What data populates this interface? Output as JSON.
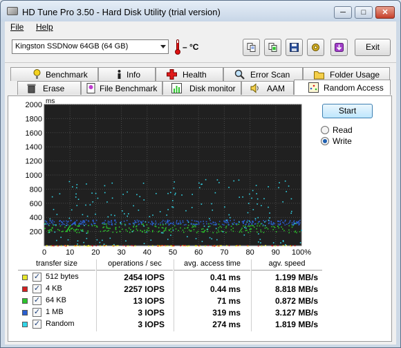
{
  "window": {
    "title": "HD Tune Pro 3.50 - Hard Disk Utility (trial version)",
    "min_label": "─",
    "max_label": "□",
    "close_label": "✕"
  },
  "menu": {
    "file": "File",
    "help": "Help"
  },
  "toolbar": {
    "drive": "Kingston SSDNow 64GB (64 GB)",
    "temperature": "– °C",
    "exit_label": "Exit",
    "icons": [
      "copy-icon",
      "copy-info-icon",
      "save-icon",
      "options-icon",
      "download-icon"
    ]
  },
  "tabs_row1": [
    "Benchmark",
    "Info",
    "Health",
    "Error Scan",
    "Folder Usage"
  ],
  "tabs_row2": [
    "Erase",
    "File Benchmark",
    "Disk monitor",
    "AAM",
    "Random Access"
  ],
  "active_tab": "Random Access",
  "controls": {
    "start_label": "Start",
    "read_label": "Read",
    "write_label": "Write",
    "mode": "Write"
  },
  "table": {
    "headers": [
      "transfer size",
      "operations / sec",
      "avg. access time",
      "agv. speed"
    ],
    "rows": [
      {
        "size": "512 bytes",
        "ops": "2454 IOPS",
        "time": "0.41 ms",
        "speed": "1.199 MB/s",
        "color": "#e8e82a",
        "checked": true
      },
      {
        "size": "4 KB",
        "ops": "2257 IOPS",
        "time": "0.44 ms",
        "speed": "8.818 MB/s",
        "color": "#d42020",
        "checked": true
      },
      {
        "size": "64 KB",
        "ops": "13 IOPS",
        "time": "71 ms",
        "speed": "0.872 MB/s",
        "color": "#2cc42c",
        "checked": true
      },
      {
        "size": "1 MB",
        "ops": "3 IOPS",
        "time": "319 ms",
        "speed": "3.127 MB/s",
        "color": "#2a5fd0",
        "checked": true
      },
      {
        "size": "Random",
        "ops": "3 IOPS",
        "time": "274 ms",
        "speed": "1.819 MB/s",
        "color": "#33d6e8",
        "checked": true
      }
    ]
  },
  "chart_data": {
    "type": "scatter",
    "ylabel": "ms",
    "xlabel": "",
    "ylim": [
      0,
      2000
    ],
    "xlim": [
      0,
      100
    ],
    "yticks": [
      "2000",
      "1800",
      "1600",
      "1400",
      "1200",
      "1000",
      "800",
      "600",
      "400",
      "200"
    ],
    "xticks": [
      "0",
      "10",
      "20",
      "30",
      "40",
      "50",
      "60",
      "70",
      "80",
      "90",
      "100%"
    ],
    "grid": true,
    "series": [
      {
        "name": "512 bytes",
        "band": [
          0,
          10
        ],
        "count": 70
      },
      {
        "name": "4 KB",
        "band": [
          0,
          10
        ],
        "count": 40
      },
      {
        "name": "64 KB",
        "band": [
          190,
          320
        ],
        "count": 260
      },
      {
        "name": "1 MB",
        "band": [
          300,
          370
        ],
        "count": 300
      },
      {
        "name": "Random",
        "band": [
          20,
          950
        ],
        "count": 180
      }
    ]
  }
}
